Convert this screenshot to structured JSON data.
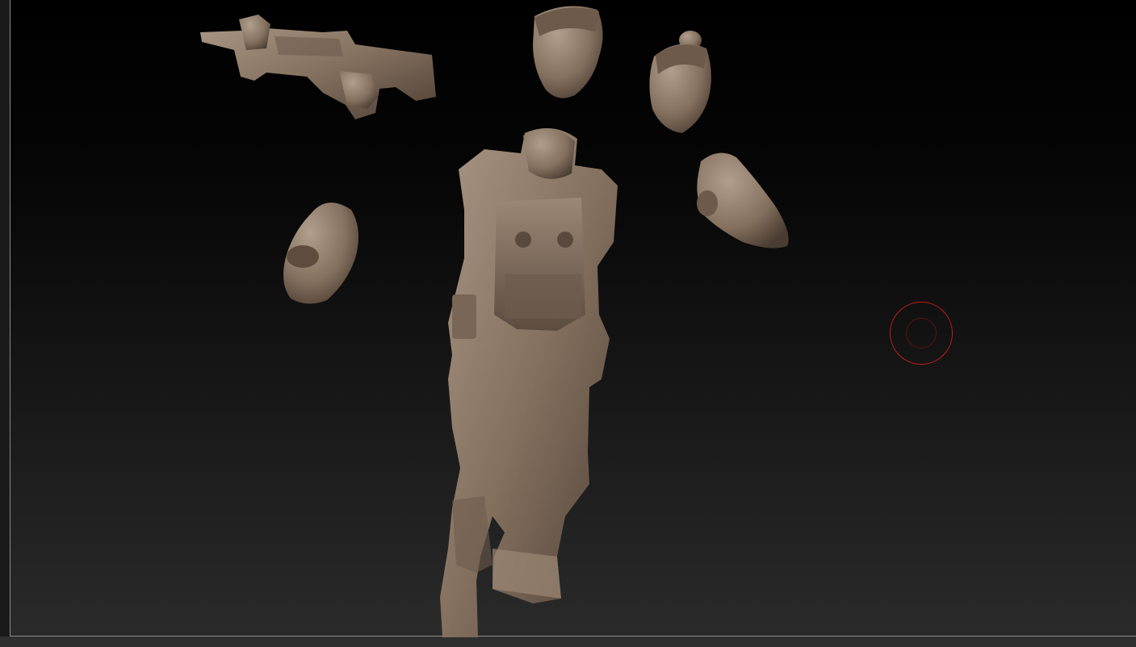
{
  "canvas": {
    "material_color": "#8a7868",
    "background_top": "#000000",
    "background_bottom": "#2a2a2a",
    "frame_color": "#8a8a8a"
  },
  "objects": [
    {
      "name": "rifle-with-hands"
    },
    {
      "name": "head-short-hair"
    },
    {
      "name": "head-bun-hair"
    },
    {
      "name": "left-arm"
    },
    {
      "name": "right-arm"
    },
    {
      "name": "armored-torso-legs"
    }
  ],
  "brush_cursor": {
    "color": "#c41c1c"
  }
}
